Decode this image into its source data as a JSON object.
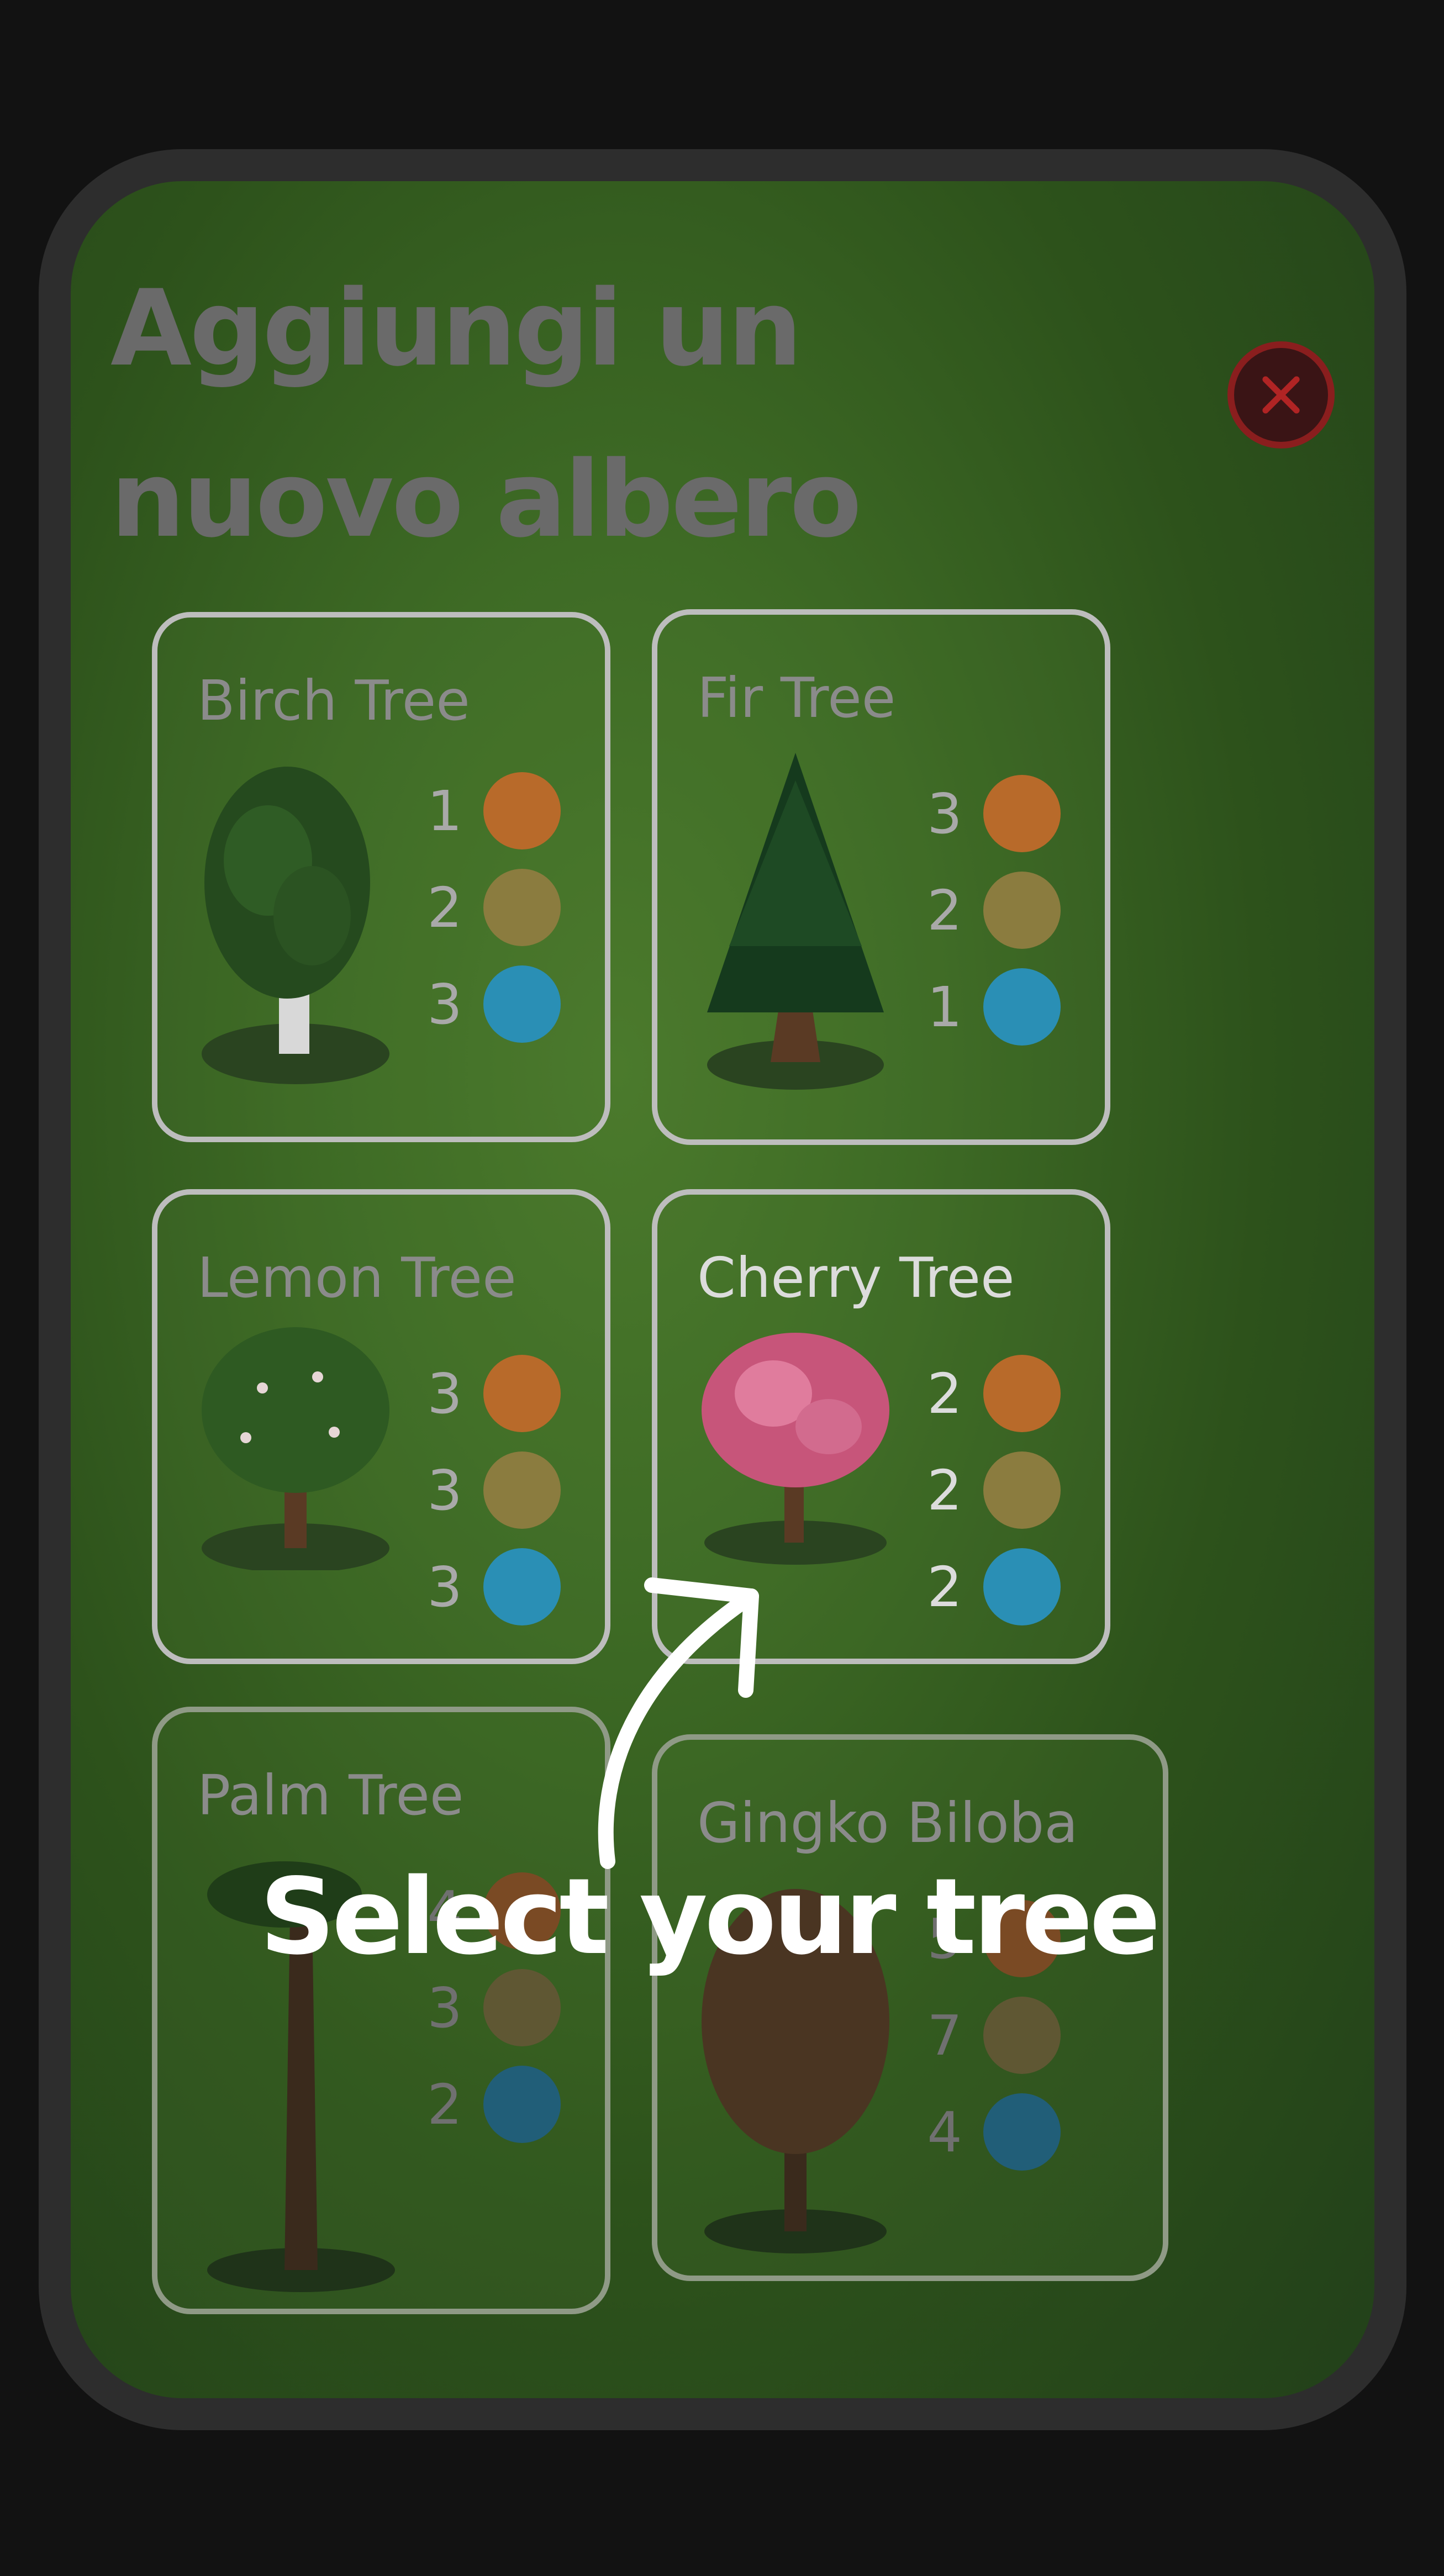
{
  "modal": {
    "title": "Aggiungi un\nnuovo albero",
    "close_icon": "close-icon"
  },
  "trees": [
    {
      "name": "Birch Tree",
      "soil": "1",
      "seeds": "2",
      "water": "3"
    },
    {
      "name": "Fir Tree",
      "soil": "3",
      "seeds": "2",
      "water": "1"
    },
    {
      "name": "Lemon Tree",
      "soil": "3",
      "seeds": "3",
      "water": "3"
    },
    {
      "name": "Cherry Tree",
      "soil": "2",
      "seeds": "2",
      "water": "2"
    },
    {
      "name": "Palm Tree",
      "soil": "4",
      "seeds": "3",
      "water": "2"
    },
    {
      "name": "Gingko Biloba",
      "soil": "5",
      "seeds": "7",
      "water": "4"
    }
  ],
  "overlay": {
    "caption": "Select your tree"
  },
  "colors": {
    "panel_green": "#3e6b25",
    "card_border": "#bdbdbd",
    "soil_icon": "#b86a2a",
    "seed_icon": "#8b7c3f",
    "water_icon": "#2a8fb5",
    "close_red": "#8a1e1e"
  }
}
